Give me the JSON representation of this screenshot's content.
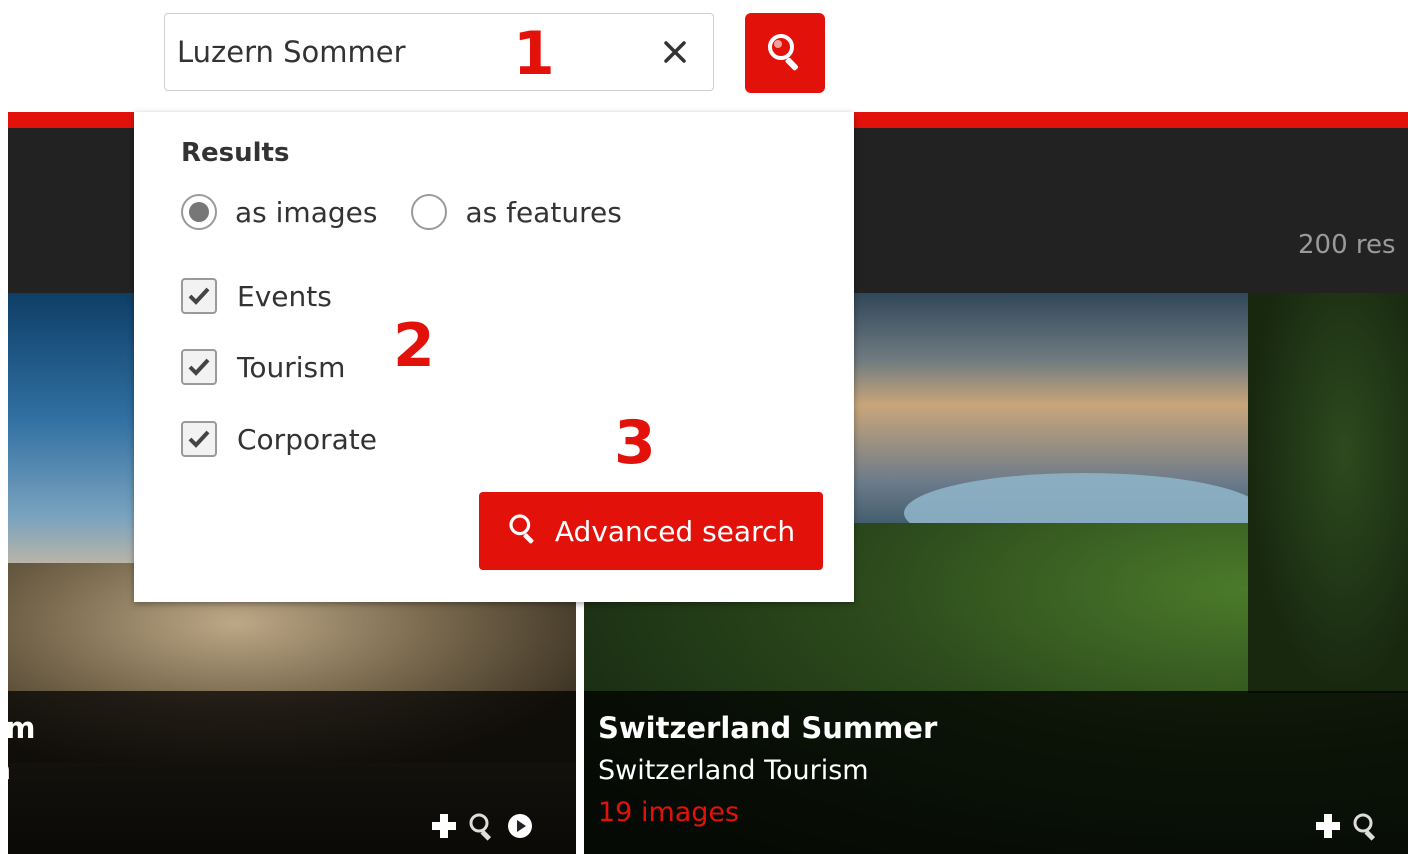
{
  "search": {
    "value": "Luzern Sommer",
    "clear_icon": "close-icon",
    "submit_icon": "search-icon"
  },
  "results_count": "200 res",
  "panel": {
    "results_heading": "Results",
    "radios": [
      {
        "label": "as images",
        "selected": true
      },
      {
        "label": "as features",
        "selected": false
      }
    ],
    "checkboxes": [
      {
        "label": "Events",
        "checked": true
      },
      {
        "label": "Tourism",
        "checked": true
      },
      {
        "label": "Corporate",
        "checked": true
      }
    ],
    "advanced_button": "Advanced search"
  },
  "annotations": [
    "1",
    "2",
    "3"
  ],
  "cards": [
    {
      "title": "sm",
      "subtitle": "n",
      "count": ""
    },
    {
      "title": "Switzerland Summer",
      "subtitle": "Switzerland Tourism",
      "count": "19 images"
    }
  ],
  "colors": {
    "accent": "#e2120b",
    "header": "#222222"
  }
}
